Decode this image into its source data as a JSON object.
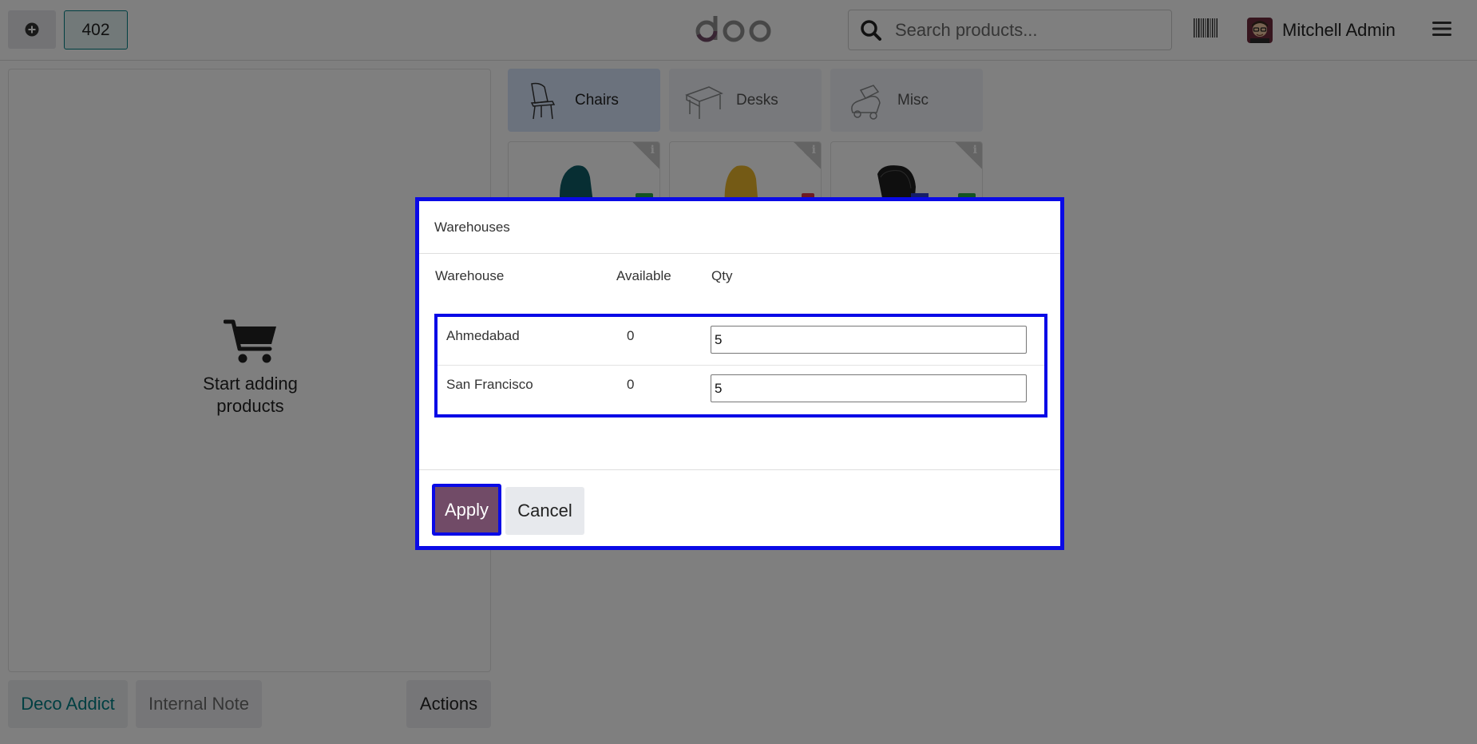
{
  "topbar": {
    "order_number": "402",
    "logo_text": "odoo",
    "search_placeholder": "Search products...",
    "user_name": "Mitchell Admin",
    "icons": [
      "plus-circle-icon",
      "barcode-icon",
      "user-avatar",
      "hamburger-menu-icon"
    ]
  },
  "left_pane": {
    "empty_text": "Start adding products",
    "customer_label": "Deco Addict",
    "note_label": "Internal Note",
    "actions_label": "Actions"
  },
  "categories": [
    {
      "label": "Chairs",
      "active": true,
      "icon": "chair-icon"
    },
    {
      "label": "Desks",
      "active": false,
      "icon": "desk-icon"
    },
    {
      "label": "Misc",
      "active": false,
      "icon": "misc-icon"
    }
  ],
  "products": [
    {
      "image": "teal-chair",
      "stock_color": "#28a745"
    },
    {
      "image": "yellow-chair",
      "stock_color": "#dc3545"
    },
    {
      "image": "black-office-chair",
      "stock_color": "#28a745"
    }
  ],
  "dialog": {
    "title": "Warehouses",
    "columns": {
      "warehouse": "Warehouse",
      "available": "Available",
      "qty": "Qty"
    },
    "rows": [
      {
        "warehouse": "Ahmedabad",
        "available": "0",
        "qty": "5"
      },
      {
        "warehouse": "San Francisco",
        "available": "0",
        "qty": "5"
      }
    ],
    "apply_label": "Apply",
    "cancel_label": "Cancel"
  },
  "colors": {
    "brand": "#714b67",
    "teal": "#017e84",
    "highlight": "#0a0ae6",
    "active_category": "#d6e4fb"
  }
}
